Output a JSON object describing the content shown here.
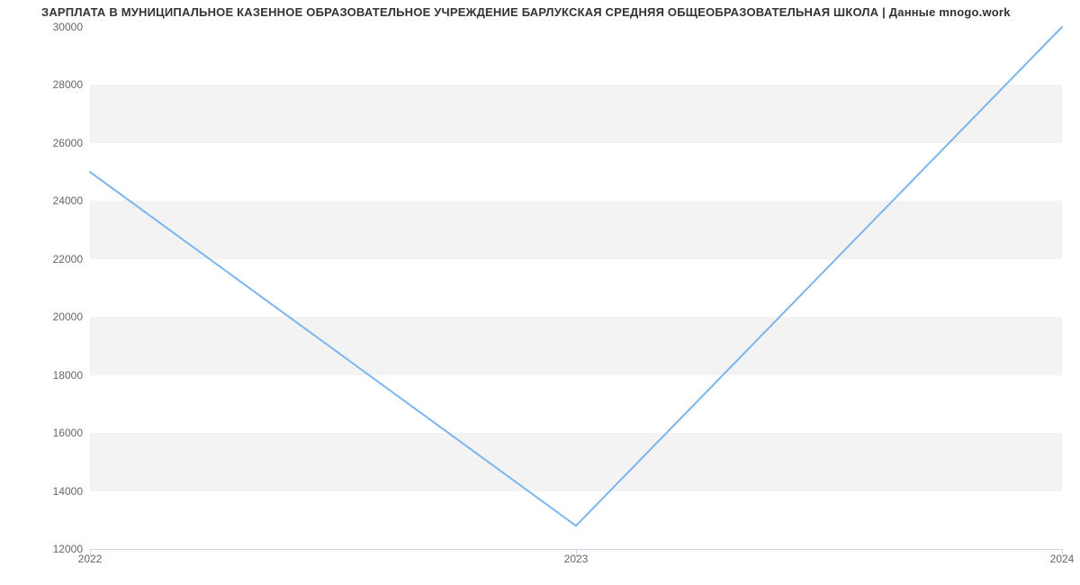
{
  "chart_data": {
    "type": "line",
    "title": "ЗАРПЛАТА В МУНИЦИПАЛЬНОЕ КАЗЕННОЕ ОБРАЗОВАТЕЛЬНОЕ УЧРЕЖДЕНИЕ БАРЛУКСКАЯ СРЕДНЯЯ ОБЩЕОБРАЗОВАТЕЛЬНАЯ ШКОЛА | Данные mnogo.work",
    "categories": [
      "2022",
      "2023",
      "2024"
    ],
    "values": [
      25000,
      12800,
      30000
    ],
    "xlabel": "",
    "ylabel": "",
    "ylim": [
      12000,
      30000
    ],
    "y_ticks": [
      12000,
      14000,
      16000,
      18000,
      20000,
      22000,
      24000,
      26000,
      28000,
      30000
    ],
    "series_color": "#7cb5ec",
    "grid_band_color": "#f3f3f3"
  }
}
